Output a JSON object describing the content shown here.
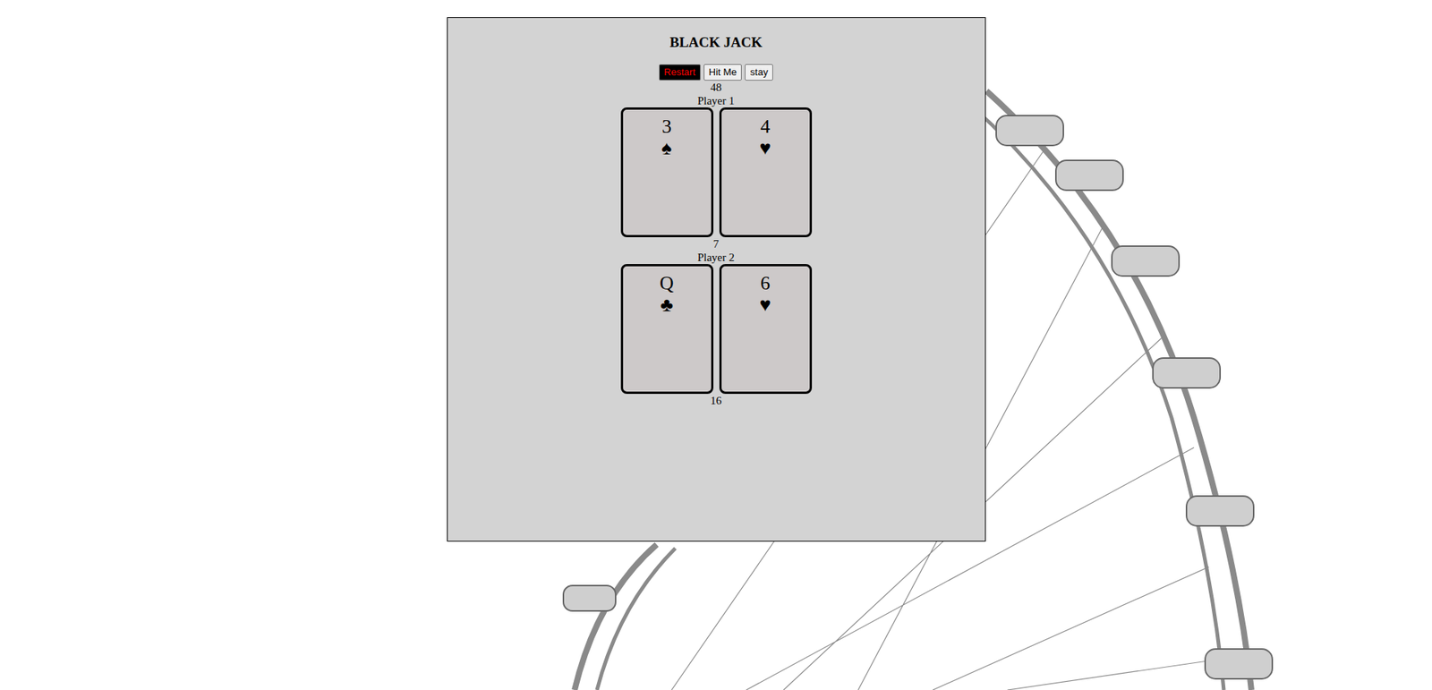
{
  "title": "BLACK JACK",
  "buttons": [
    {
      "label": "Restart",
      "kind": "danger"
    },
    {
      "label": "Hit Me",
      "kind": "plain"
    },
    {
      "label": "stay",
      "kind": "plain"
    }
  ],
  "deck_count": "48",
  "players": [
    {
      "name": "Player 1",
      "cards": [
        {
          "rank": "3",
          "suit": "♠"
        },
        {
          "rank": "4",
          "suit": "♥"
        }
      ],
      "total": "7"
    },
    {
      "name": "Player 2",
      "cards": [
        {
          "rank": "Q",
          "suit": "♣"
        },
        {
          "rank": "6",
          "suit": "♥"
        }
      ],
      "total": "16"
    }
  ]
}
